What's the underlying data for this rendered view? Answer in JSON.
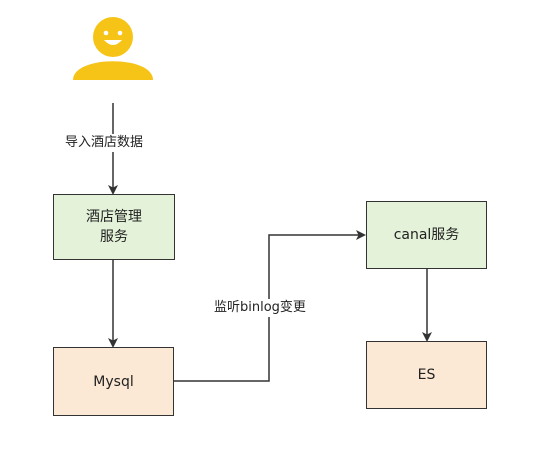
{
  "nodes": {
    "user": {
      "icon": "user-smiley-icon",
      "color": "#f5c417"
    },
    "hotel_service": {
      "label": "酒店管理\n服务",
      "fill": "#e4f2d9"
    },
    "mysql": {
      "label": "Mysql",
      "fill": "#fbe9d6"
    },
    "canal": {
      "label": "canal服务",
      "fill": "#e4f2d9"
    },
    "es": {
      "label": "ES",
      "fill": "#fbe9d6"
    }
  },
  "edges": {
    "import": {
      "label": "导入酒店数据"
    },
    "binlog": {
      "label": "监听binlog变更"
    }
  },
  "colors": {
    "stroke": "#333333"
  }
}
